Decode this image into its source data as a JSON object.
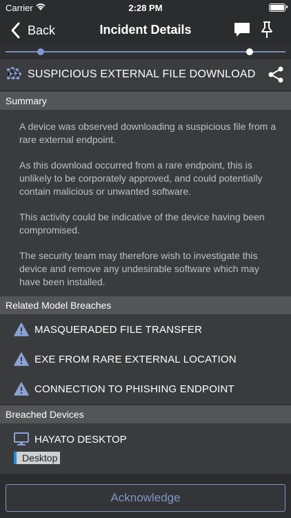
{
  "status_bar": {
    "carrier": "Carrier",
    "time": "2:28 PM"
  },
  "nav": {
    "back_label": "Back",
    "title": "Incident Details"
  },
  "timeline": {
    "start_fraction": 0.12,
    "end_fraction": 0.87
  },
  "incident": {
    "title": "SUSPICIOUS EXTERNAL FILE DOWNLOAD"
  },
  "summary": {
    "header": "Summary",
    "paragraphs": [
      "A device was observed downloading a suspicious file from a rare external endpoint.",
      "As this download occurred from a rare endpoint, this is unlikely to be corporately approved, and could potentially contain malicious or unwanted software.",
      "This activity could be indicative of the device having been compromised.",
      "The security team may therefore wish to investigate this device and remove any undesirable software which may have been installed."
    ]
  },
  "breaches": {
    "header": "Related Model Breaches",
    "items": [
      {
        "label": "MASQUERADED FILE TRANSFER"
      },
      {
        "label": "EXE FROM RARE EXTERNAL LOCATION"
      },
      {
        "label": "CONNECTION TO PHISHING ENDPOINT"
      }
    ]
  },
  "devices": {
    "header": "Breached Devices",
    "items": [
      {
        "name": "HAYATO DESKTOP",
        "tag": "Desktop"
      }
    ]
  },
  "actions": {
    "acknowledge_label": "Acknowledge"
  },
  "colors": {
    "accent": "#7e96c9",
    "warning_icon": "#8aa2d6",
    "tag_marker": "#1d8fe0"
  }
}
